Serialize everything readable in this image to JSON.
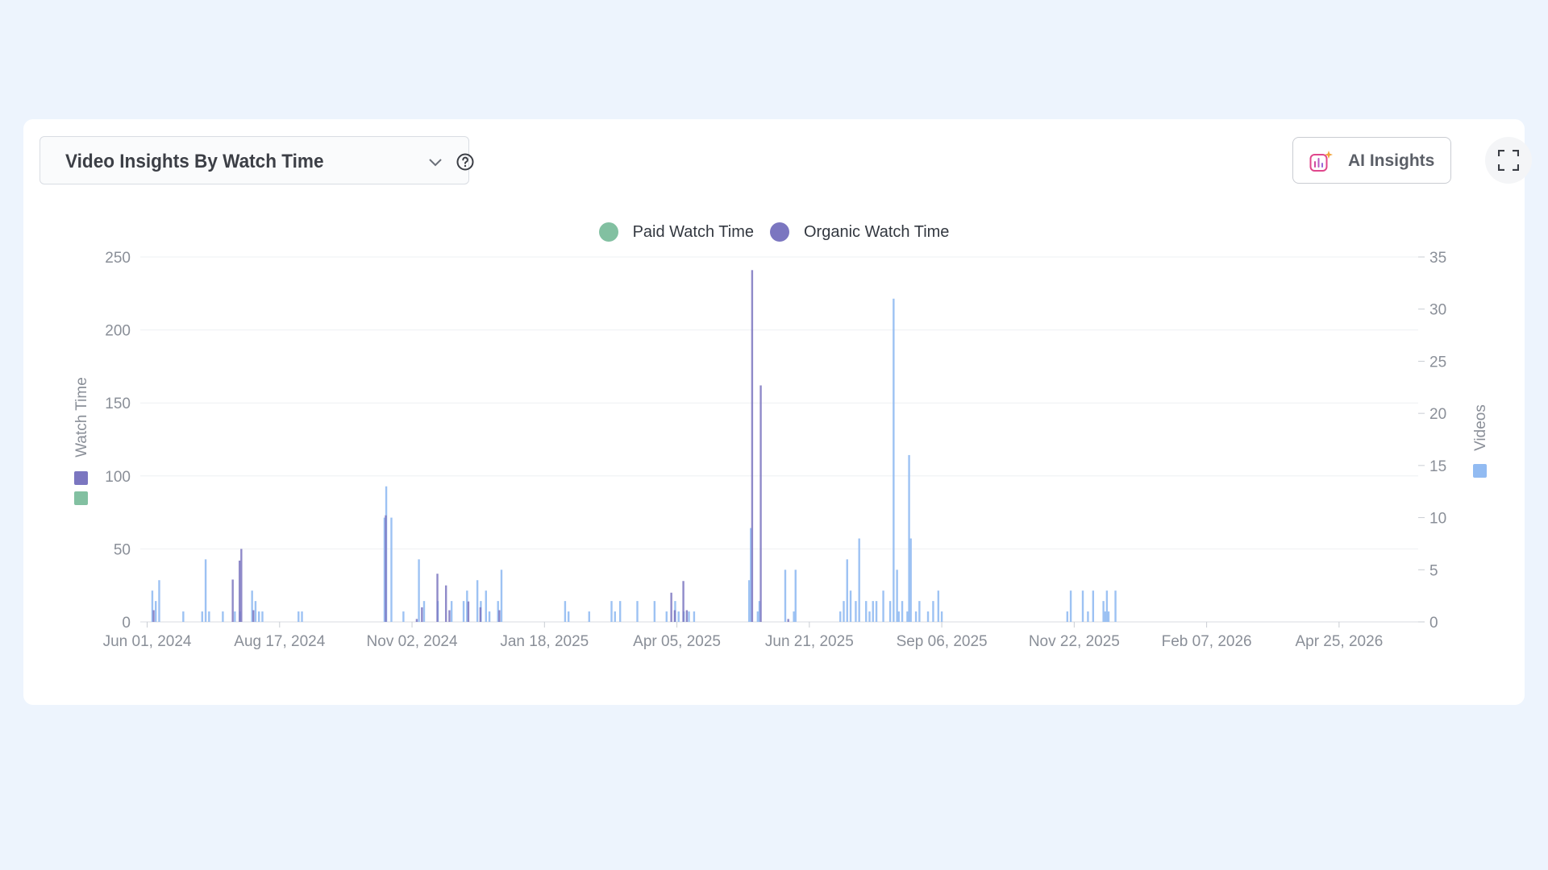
{
  "header": {
    "selector_label": "Video Insights By Watch Time",
    "ai_button_label": "AI Insights"
  },
  "icons": {
    "selector_chevron": "chevron-down-icon",
    "help": "help-circle-icon",
    "ai": "ai-chart-sparkle-icon",
    "expand": "fullscreen-icon"
  },
  "colors": {
    "paid": "#82c0a1",
    "organic": "#7b76c0",
    "videos": "#92bbf2",
    "page_background": "#edf4fd"
  },
  "chart_data": {
    "type": "bar",
    "title": "",
    "legend": {
      "placement": "top-center",
      "entries": [
        "Paid Watch Time",
        "Organic Watch Time"
      ]
    },
    "x_axis": {
      "tick_labels": [
        "Jun 01, 2024",
        "Aug 17, 2024",
        "Nov 02, 2024",
        "Jan 18, 2025",
        "Apr 05, 2025",
        "Jun 21, 2025",
        "Sep 06, 2025",
        "Nov 22, 2025",
        "Feb 07, 2026",
        "Apr 25, 2026"
      ],
      "range": [
        "2024-05-28",
        "2026-06-10"
      ]
    },
    "y_axis_left": {
      "label": "Watch Time",
      "range": [
        0,
        250
      ],
      "ticks": [
        0,
        50,
        100,
        150,
        200,
        250
      ]
    },
    "y_axis_right": {
      "label": "Videos",
      "range": [
        0,
        35
      ],
      "ticks": [
        0,
        5,
        10,
        15,
        20,
        25,
        30,
        35
      ]
    },
    "grid": true,
    "series": [
      {
        "name": "Paid Watch Time",
        "axis": "left",
        "points": []
      },
      {
        "name": "Organic Watch Time",
        "axis": "left",
        "points": [
          [
            "2024-06-04",
            8
          ],
          [
            "2024-07-20",
            29
          ],
          [
            "2024-07-24",
            42
          ],
          [
            "2024-07-25",
            50
          ],
          [
            "2024-08-01",
            8
          ],
          [
            "2024-10-17",
            73
          ],
          [
            "2024-11-04",
            2
          ],
          [
            "2024-11-07",
            10
          ],
          [
            "2024-11-16",
            33
          ],
          [
            "2024-11-21",
            25
          ],
          [
            "2024-11-23",
            8
          ],
          [
            "2024-12-04",
            14
          ],
          [
            "2024-12-11",
            10
          ],
          [
            "2024-12-22",
            8
          ],
          [
            "2025-04-01",
            20
          ],
          [
            "2025-04-03",
            8
          ],
          [
            "2025-04-08",
            28
          ],
          [
            "2025-04-10",
            8
          ],
          [
            "2025-05-18",
            241
          ],
          [
            "2025-05-23",
            162
          ],
          [
            "2025-06-08",
            2
          ]
        ]
      },
      {
        "name": "Videos",
        "axis": "right",
        "points": [
          [
            "2024-06-04",
            3
          ],
          [
            "2024-06-06",
            2
          ],
          [
            "2024-06-08",
            4
          ],
          [
            "2024-06-22",
            1
          ],
          [
            "2024-07-03",
            1
          ],
          [
            "2024-07-05",
            6
          ],
          [
            "2024-07-07",
            1
          ],
          [
            "2024-07-15",
            1
          ],
          [
            "2024-07-22",
            1
          ],
          [
            "2024-07-25",
            1
          ],
          [
            "2024-08-01",
            3
          ],
          [
            "2024-08-03",
            2
          ],
          [
            "2024-08-05",
            1
          ],
          [
            "2024-08-07",
            1
          ],
          [
            "2024-08-28",
            1
          ],
          [
            "2024-08-30",
            1
          ],
          [
            "2024-10-17",
            10
          ],
          [
            "2024-10-18",
            13
          ],
          [
            "2024-10-21",
            10
          ],
          [
            "2024-10-28",
            1
          ],
          [
            "2024-11-06",
            6
          ],
          [
            "2024-11-09",
            2
          ],
          [
            "2024-11-17",
            2
          ],
          [
            "2024-11-25",
            2
          ],
          [
            "2024-12-02",
            2
          ],
          [
            "2024-12-04",
            3
          ],
          [
            "2024-12-10",
            4
          ],
          [
            "2024-12-12",
            2
          ],
          [
            "2024-12-15",
            3
          ],
          [
            "2024-12-17",
            1
          ],
          [
            "2024-12-22",
            2
          ],
          [
            "2024-12-24",
            5
          ],
          [
            "2025-01-30",
            2
          ],
          [
            "2025-02-01",
            1
          ],
          [
            "2025-02-13",
            1
          ],
          [
            "2025-02-26",
            2
          ],
          [
            "2025-02-28",
            1
          ],
          [
            "2025-03-03",
            2
          ],
          [
            "2025-03-13",
            2
          ],
          [
            "2025-03-23",
            2
          ],
          [
            "2025-03-30",
            1
          ],
          [
            "2025-04-04",
            2
          ],
          [
            "2025-04-06",
            1
          ],
          [
            "2025-04-09",
            1
          ],
          [
            "2025-04-12",
            1
          ],
          [
            "2025-04-15",
            1
          ],
          [
            "2025-05-17",
            4
          ],
          [
            "2025-05-18",
            9
          ],
          [
            "2025-05-22",
            1
          ],
          [
            "2025-05-23",
            2
          ],
          [
            "2025-06-07",
            5
          ],
          [
            "2025-06-12",
            1
          ],
          [
            "2025-06-13",
            5
          ],
          [
            "2025-07-09",
            1
          ],
          [
            "2025-07-11",
            2
          ],
          [
            "2025-07-13",
            6
          ],
          [
            "2025-07-15",
            3
          ],
          [
            "2025-07-18",
            2
          ],
          [
            "2025-07-20",
            8
          ],
          [
            "2025-07-24",
            2
          ],
          [
            "2025-07-26",
            1
          ],
          [
            "2025-07-28",
            2
          ],
          [
            "2025-07-30",
            2
          ],
          [
            "2025-08-03",
            3
          ],
          [
            "2025-08-07",
            2
          ],
          [
            "2025-08-09",
            31
          ],
          [
            "2025-08-11",
            5
          ],
          [
            "2025-08-12",
            1
          ],
          [
            "2025-08-14",
            2
          ],
          [
            "2025-08-17",
            1
          ],
          [
            "2025-08-18",
            16
          ],
          [
            "2025-08-19",
            8
          ],
          [
            "2025-08-22",
            1
          ],
          [
            "2025-08-24",
            2
          ],
          [
            "2025-08-29",
            1
          ],
          [
            "2025-09-01",
            2
          ],
          [
            "2025-09-04",
            3
          ],
          [
            "2025-09-06",
            1
          ],
          [
            "2025-11-18",
            1
          ],
          [
            "2025-11-20",
            3
          ],
          [
            "2025-11-27",
            3
          ],
          [
            "2025-11-30",
            1
          ],
          [
            "2025-12-03",
            3
          ],
          [
            "2025-12-09",
            2
          ],
          [
            "2025-12-10",
            1
          ],
          [
            "2025-12-11",
            3
          ],
          [
            "2025-12-12",
            1
          ],
          [
            "2025-12-16",
            3
          ]
        ]
      }
    ]
  }
}
